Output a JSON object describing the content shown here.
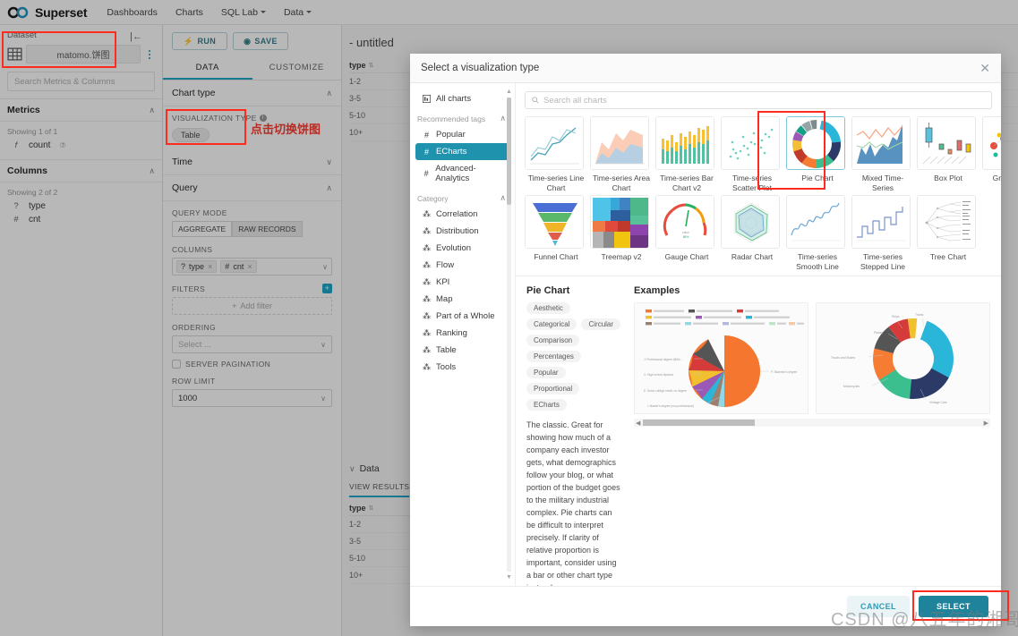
{
  "navbar": {
    "brand": "Superset",
    "links": [
      {
        "label": "Dashboards",
        "has_caret": false
      },
      {
        "label": "Charts",
        "has_caret": false
      },
      {
        "label": "SQL Lab",
        "has_caret": true
      },
      {
        "label": "Data",
        "has_caret": true
      }
    ]
  },
  "dataset_panel": {
    "label": "Dataset",
    "dataset_name": "matomo.饼图",
    "search_placeholder": "Search Metrics & Columns",
    "metrics": {
      "title": "Metrics",
      "showing": "Showing 1 of 1",
      "items": [
        {
          "icon": "f",
          "name": "count",
          "suffix": "⑦"
        }
      ]
    },
    "columns": {
      "title": "Columns",
      "showing": "Showing 2 of 2",
      "items": [
        {
          "icon": "?",
          "name": "type"
        },
        {
          "icon": "#",
          "name": "cnt"
        }
      ]
    }
  },
  "control_panel": {
    "run_label": "RUN",
    "save_label": "SAVE",
    "tabs": [
      {
        "label": "DATA",
        "active": true
      },
      {
        "label": "CUSTOMIZE",
        "active": false
      }
    ],
    "sections": {
      "chart_type": "Chart type",
      "time": "Time",
      "query": "Query"
    },
    "viz_type_label": "VISUALIZATION TYPE",
    "viz_type_value": "Table",
    "query_mode_label": "QUERY MODE",
    "query_mode_options": [
      {
        "label": "AGGREGATE",
        "selected": false
      },
      {
        "label": "RAW RECORDS",
        "selected": true
      }
    ],
    "columns_label": "COLUMNS",
    "columns_chips": [
      {
        "icon": "?",
        "label": "type"
      },
      {
        "icon": "#",
        "label": "cnt"
      }
    ],
    "filters_label": "FILTERS",
    "add_filter_label": "Add filter",
    "ordering_label": "ORDERING",
    "ordering_placeholder": "Select ...",
    "server_pagination_label": "SERVER PAGINATION",
    "row_limit_label": "ROW LIMIT",
    "row_limit_value": "1000"
  },
  "main_area": {
    "chart_title": "- untitled",
    "table_header": "type",
    "table_rows": [
      "1-2",
      "3-5",
      "5-10",
      "10+"
    ],
    "data_section_title": "Data",
    "view_results_tab": "VIEW RESULTS",
    "data_table_header": "type",
    "data_table_rows": [
      "1-2",
      "3-5",
      "5-10",
      "10+"
    ]
  },
  "modal": {
    "title": "Select a visualization type",
    "close_icon": "✕",
    "search_placeholder": "Search all charts",
    "categories": {
      "all_charts": "All charts",
      "recommended_tags_label": "Recommended tags",
      "tags": [
        {
          "label": "Popular",
          "selected": false
        },
        {
          "label": "ECharts",
          "selected": true
        },
        {
          "label": "Advanced-Analytics",
          "selected": false
        }
      ],
      "category_label": "Category",
      "items": [
        "Correlation",
        "Distribution",
        "Evolution",
        "Flow",
        "KPI",
        "Map",
        "Part of a Whole",
        "Ranking",
        "Table",
        "Tools"
      ]
    },
    "charts": [
      {
        "name": "Time-series Line Chart",
        "kind": "line",
        "selected": false
      },
      {
        "name": "Time-series Area Chart",
        "kind": "area",
        "selected": false
      },
      {
        "name": "Time-series Bar Chart v2",
        "kind": "bar",
        "selected": false
      },
      {
        "name": "Time-series Scatter Plot",
        "kind": "scatter",
        "selected": false
      },
      {
        "name": "Pie Chart",
        "kind": "donut",
        "selected": true
      },
      {
        "name": "Mixed Time-Series",
        "kind": "mixed",
        "selected": false
      },
      {
        "name": "Box Plot",
        "kind": "box",
        "selected": false
      },
      {
        "name": "Graph Chart",
        "kind": "graph",
        "selected": false
      },
      {
        "name": "Funnel Chart",
        "kind": "funnel",
        "selected": false
      },
      {
        "name": "Treemap v2",
        "kind": "treemap",
        "selected": false
      },
      {
        "name": "Gauge Chart",
        "kind": "gauge",
        "selected": false
      },
      {
        "name": "Radar Chart",
        "kind": "radar",
        "selected": false
      },
      {
        "name": "Time-series Smooth Line",
        "kind": "smooth",
        "selected": false
      },
      {
        "name": "Time-series Stepped Line",
        "kind": "stepped",
        "selected": false
      },
      {
        "name": "Tree Chart",
        "kind": "tree",
        "selected": false
      }
    ],
    "detail": {
      "title": "Pie Chart",
      "tags": [
        "Aesthetic",
        "Categorical",
        "Circular",
        "Comparison",
        "Percentages",
        "Popular",
        "Proportional",
        "ECharts"
      ],
      "description": "The classic. Great for showing how much of a company each investor gets, what demographics follow your blog, or what portion of the budget goes to the military industrial complex. Pie charts can be difficult to interpret precisely. If clarity of relative proportion is important, consider using a bar or other chart type instead."
    },
    "examples_title": "Examples",
    "footer": {
      "cancel_label": "CANCEL",
      "select_label": "SELECT"
    }
  },
  "annotations": {
    "chinese_note": "点击切换饼图",
    "watermark": "CSDN @八五年的湘哥"
  },
  "colors": {
    "accent_teal": "#20a7c9",
    "selected_tag": "#1f93ae",
    "highlight_red": "#ff2b1e",
    "select_button": "#20839c"
  }
}
